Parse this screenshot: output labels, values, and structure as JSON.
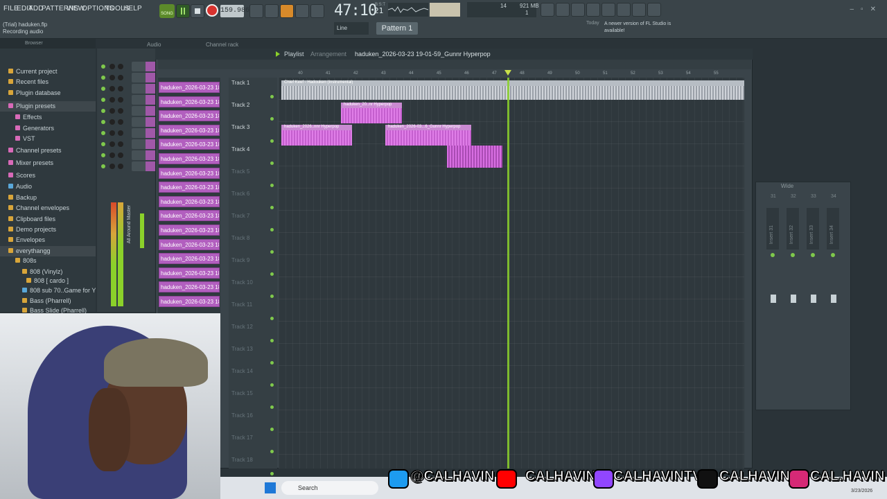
{
  "menu": [
    "FILE",
    "EDIT",
    "ADD",
    "PATTERNS",
    "VIEW",
    "OPTIONS",
    "TOOLS",
    "HELP"
  ],
  "window": {
    "file_name": "(Trial) haduken.flp",
    "status": "Recording audio"
  },
  "transport": {
    "mode_label": "SONG",
    "tempo": "159.986",
    "time": "47:10",
    "time_ticks": "21",
    "time_unit": "B:S:T",
    "cpu": "14",
    "memory": "921 MB",
    "voices": "1"
  },
  "toolbar": {
    "snap": "Line",
    "pattern": "Pattern 1"
  },
  "news": {
    "title": "Today",
    "text": "A newer version of FL Studio is available!"
  },
  "browser": {
    "header": "Browser",
    "items": [
      {
        "label": "Current project",
        "color": "#d8a53a"
      },
      {
        "label": "Recent files",
        "color": "#d8a53a"
      },
      {
        "label": "Plugin database",
        "color": "#d8a53a"
      },
      {
        "label": "Plugin presets",
        "color": "#d86ab8"
      },
      {
        "label": "Effects",
        "color": "#d86ab8"
      },
      {
        "label": "Generators",
        "color": "#d86ab8"
      },
      {
        "label": "VST",
        "color": "#d86ab8"
      },
      {
        "label": "Channel presets",
        "color": "#d86ab8"
      },
      {
        "label": "Mixer presets",
        "color": "#d86ab8"
      },
      {
        "label": "Scores",
        "color": "#d86ab8"
      },
      {
        "label": "Audio",
        "color": "#5aa7d8"
      },
      {
        "label": "Backup",
        "color": "#d8a53a"
      },
      {
        "label": "Channel envelopes",
        "color": "#d8a53a"
      },
      {
        "label": "Clipboard files",
        "color": "#d8a53a"
      },
      {
        "label": "Demo projects",
        "color": "#d8a53a"
      },
      {
        "label": "Envelopes",
        "color": "#d8a53a"
      },
      {
        "label": "everythangg",
        "color": "#d8a53a"
      },
      {
        "label": "808s",
        "color": "#d8a53a"
      },
      {
        "label": "808 (Vinylz)",
        "color": "#d8a53a"
      },
      {
        "label": "808 [ cardo ]",
        "color": "#d8a53a"
      },
      {
        "label": "808 sub 70..Game for You",
        "color": "#5aa7d8"
      },
      {
        "label": "Bass (Pharrell)",
        "color": "#d8a53a"
      },
      {
        "label": "Bass Slide (Pharrell)",
        "color": "#d8a53a"
      }
    ]
  },
  "panels": {
    "audio_tab": "Audio",
    "channel_rack": "Channel rack"
  },
  "mini_mixer": {
    "label": "All Around Master"
  },
  "playlist": {
    "title": "Playlist",
    "section": "Arrangement",
    "song": "haduken_2026-03-23 19-01-59_Gunnr Hyperpop",
    "picker_clips": [
      "haduken_2026-03-23 18..",
      "haduken_2026-03-23 18..",
      "haduken_2026-03-23 18..",
      "haduken_2026-03-23 18..",
      "haduken_2026-03-23 18..",
      "haduken_2026-03-23 18..",
      "haduken_2026-03-23 18..",
      "haduken_2026-03-23 18..",
      "haduken_2026-03-23 18..",
      "haduken_2026-03-23 18..",
      "haduken_2026-03-23 18..",
      "haduken_2026-03-23 18..",
      "haduken_2026-03-23 18..",
      "haduken_2026-03-23 18..",
      "haduken_2026-03-23 18..",
      "haduken_2026-03-23 18.."
    ],
    "tracks": [
      "Track 1",
      "Track 2",
      "Track 3",
      "Track 4",
      "Track 5",
      "Track 6",
      "Track 7",
      "Track 8",
      "Track 9",
      "Track 10",
      "Track 11",
      "Track 12",
      "Track 13",
      "Track 14",
      "Track 15",
      "Track 16",
      "Track 17",
      "Track 18"
    ],
    "ruler": [
      "40",
      "41",
      "42",
      "43",
      "44",
      "45",
      "46",
      "47",
      "48",
      "49",
      "50",
      "51",
      "52",
      "53",
      "54",
      "55"
    ],
    "clips": {
      "track1": "Chief Keef - Hadouken (Instrumental)",
      "track2": "haduken_20..nr Hyperpop",
      "track3a": "haduken_2026..nnr Hyperpop",
      "track3b": "haduken_2026-03...6_Gunnr Hyperpop"
    }
  },
  "wide_mixer": {
    "title": "Wide",
    "numbers": [
      "31",
      "32",
      "33",
      "34"
    ],
    "inserts": [
      "Insert 31",
      "Insert 32",
      "Insert 33",
      "Insert 34"
    ]
  },
  "taskbar": {
    "search": "Search",
    "date": "3/23/2026"
  },
  "socials": [
    {
      "icon": "twitter-icon",
      "handle": "@CALHAVIN",
      "color": "#1d9bf0"
    },
    {
      "icon": "youtube-icon",
      "handle": "CALHAVIN",
      "color": "#ff0000"
    },
    {
      "icon": "twitch-icon",
      "handle": "CALHAVINTV",
      "color": "#9146ff"
    },
    {
      "icon": "tiktok-icon",
      "handle": "CALHAVIN",
      "color": "#111111"
    },
    {
      "icon": "instagram-icon",
      "handle": "CAL.HAVIN",
      "color": "#d62976"
    }
  ]
}
